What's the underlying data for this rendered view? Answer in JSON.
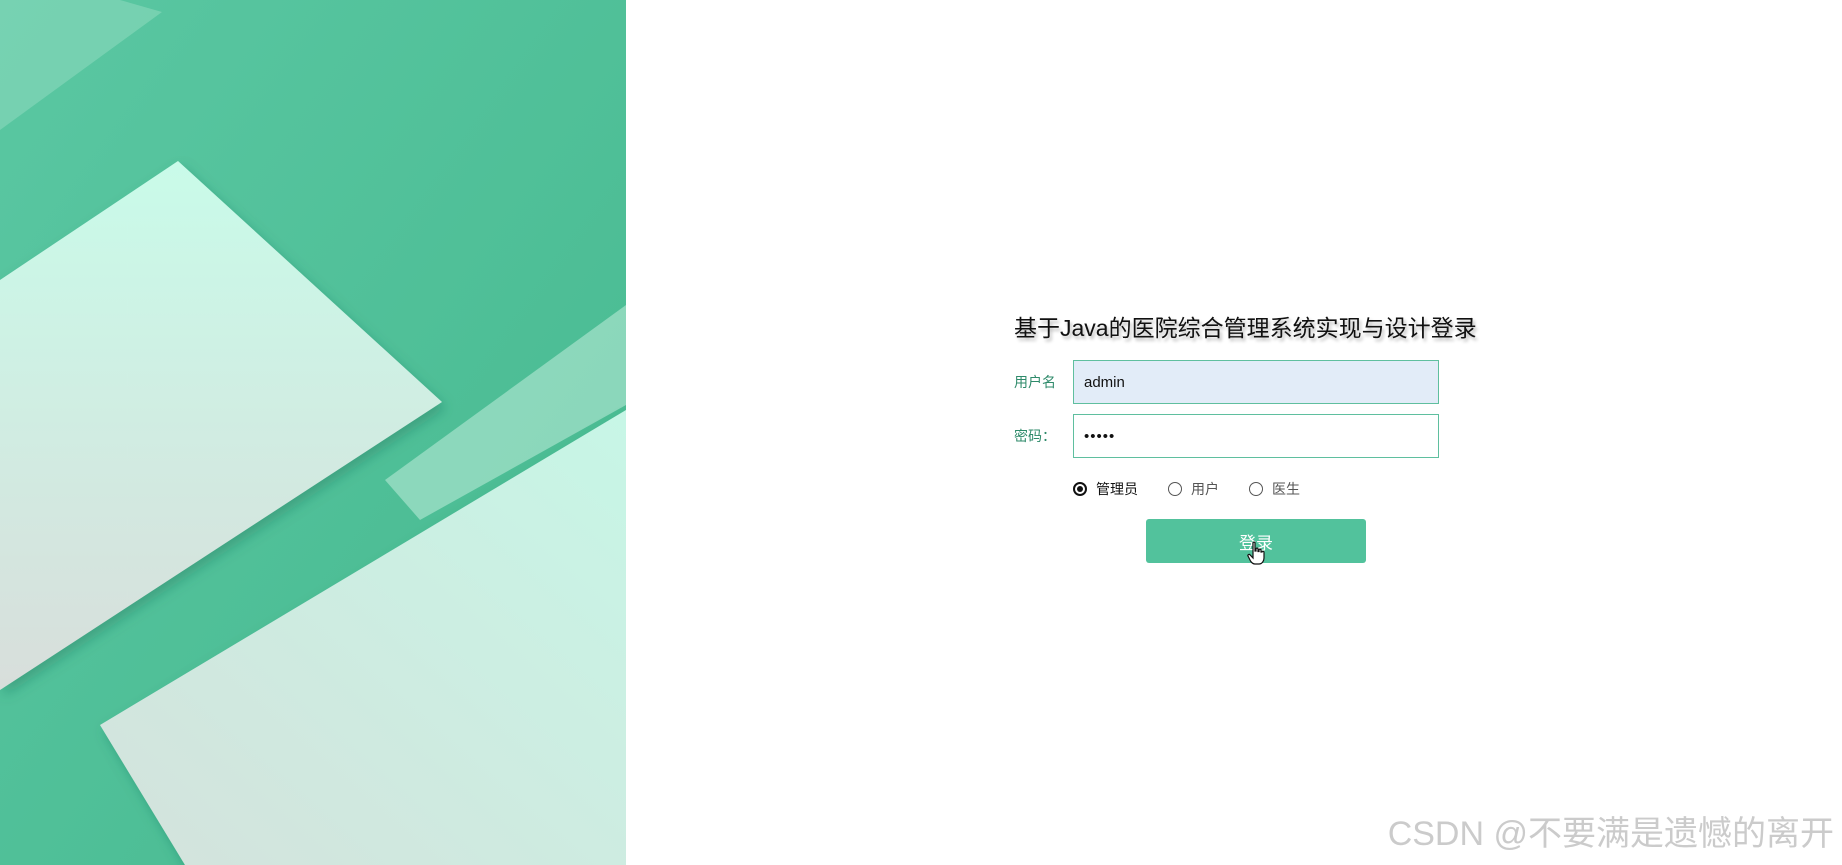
{
  "login": {
    "title": "基于Java的医院综合管理系统实现与设计登录",
    "username_label": "用户名",
    "username_value": "admin",
    "password_label": "密码：",
    "password_value": "admin",
    "roles": [
      {
        "label": "管理员",
        "selected": true
      },
      {
        "label": "用户",
        "selected": false
      },
      {
        "label": "医生",
        "selected": false
      }
    ],
    "submit_label": "登录"
  },
  "watermark": "CSDN @不要满是遗憾的离开",
  "colors": {
    "accent": "#52c29c",
    "accent_light": "#c7f6e6",
    "input_border": "#5fbf9f",
    "label_text": "#2e8a6a"
  },
  "icons": {
    "cursor": "hand-pointer-icon"
  }
}
